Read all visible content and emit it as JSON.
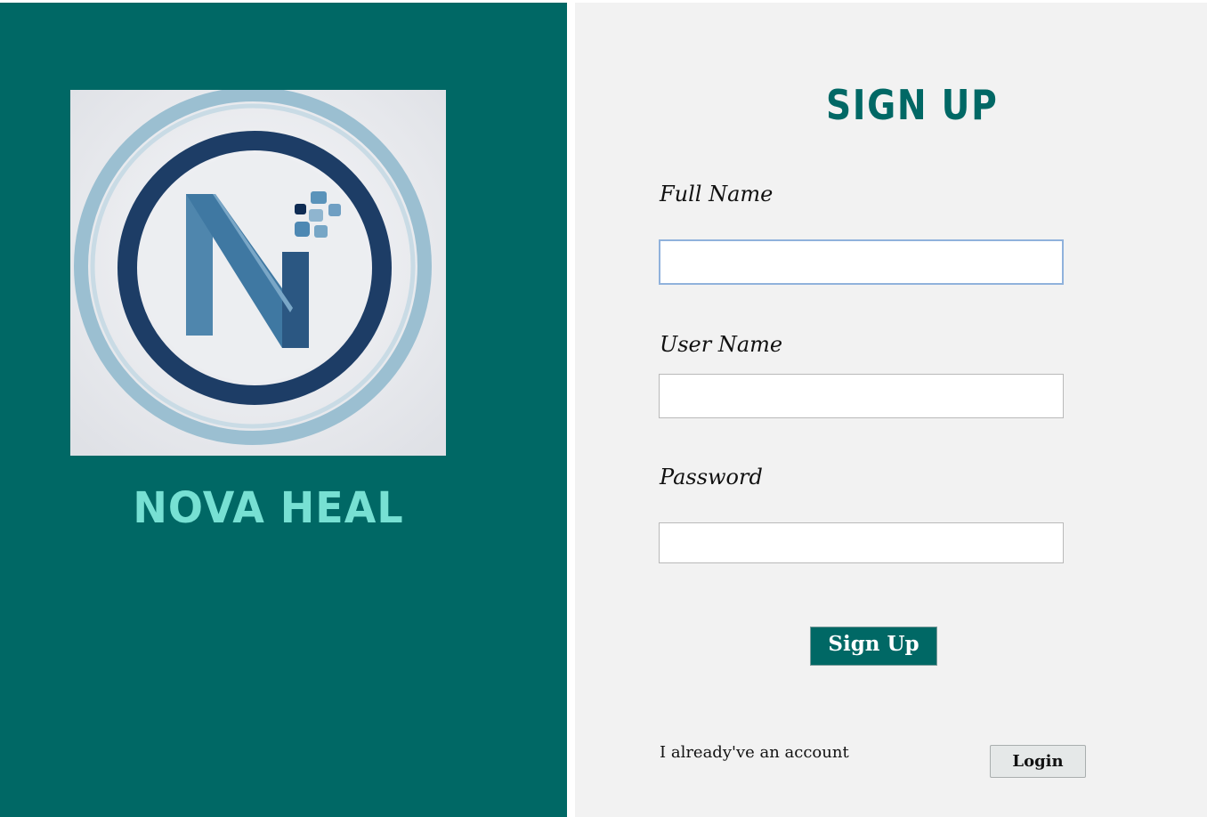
{
  "brand": {
    "name": "NOVA HEAL",
    "logo_letter": "N",
    "colors": {
      "primary": "#006865",
      "accent": "#77e0d3",
      "panel": "#f2f2f2"
    }
  },
  "form": {
    "title": "SIGN UP",
    "fields": [
      {
        "label": "Full Name",
        "value": "",
        "focused": true
      },
      {
        "label": "User Name",
        "value": ""
      },
      {
        "label": "Password",
        "value": ""
      }
    ],
    "submit_label": "Sign Up",
    "account_text": "I already've an account",
    "login_label": "Login"
  }
}
